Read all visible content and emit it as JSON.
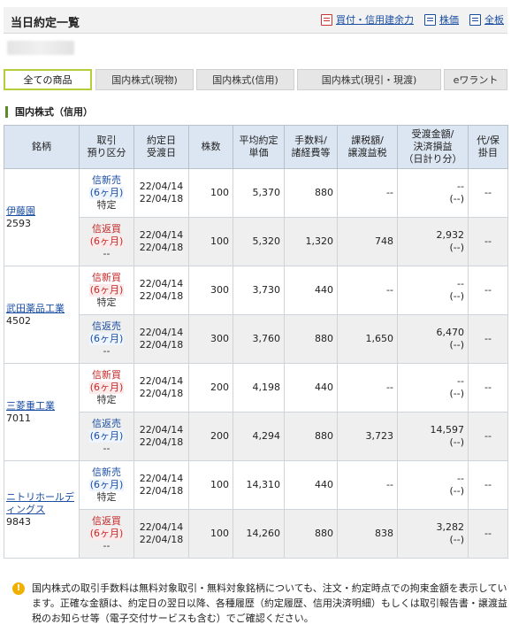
{
  "header": {
    "title": "当日約定一覧",
    "links": [
      "買付・信用建余力",
      "株価",
      "全板"
    ]
  },
  "tabs": [
    "全ての商品",
    "国内株式(現物)",
    "国内株式(信用)",
    "国内株式(現引・現渡)",
    "eワラント"
  ],
  "section": {
    "title": "国内株式（信用）"
  },
  "table": {
    "headers": {
      "name": "銘柄",
      "trade": "取引\n預り区分",
      "date": "約定日\n受渡日",
      "qty": "株数",
      "price": "平均約定\n単価",
      "fee": "手数料/\n諸経費等",
      "tax": "課税額/\n譲渡益税",
      "settle": "受渡金額/\n決済損益\n（日計り分）",
      "sub": "代/保\n掛目"
    },
    "groups": [
      {
        "name": "伊藤園",
        "code": "2593",
        "rows": [
          {
            "type": "信新売",
            "days": "(6ヶ月)",
            "acct": "特定",
            "d1": "22/04/14",
            "d2": "22/04/18",
            "qty": "100",
            "price": "5,370",
            "fee": "880",
            "tax": "--",
            "s1": "--",
            "s2": "(--)",
            "sub": "--"
          },
          {
            "type": "信返買",
            "days": "(6ヶ月)",
            "acct": "--",
            "d1": "22/04/14",
            "d2": "22/04/18",
            "qty": "100",
            "price": "5,320",
            "fee": "1,320",
            "tax": "748",
            "s1": "2,932",
            "s2": "(--)",
            "sub": "--"
          }
        ]
      },
      {
        "name": "武田薬品工業",
        "code": "4502",
        "rows": [
          {
            "type": "信新買",
            "days": "(6ヶ月)",
            "acct": "特定",
            "d1": "22/04/14",
            "d2": "22/04/18",
            "qty": "300",
            "price": "3,730",
            "fee": "440",
            "tax": "--",
            "s1": "--",
            "s2": "(--)",
            "sub": "--"
          },
          {
            "type": "信返売",
            "days": "(6ヶ月)",
            "acct": "--",
            "d1": "22/04/14",
            "d2": "22/04/18",
            "qty": "300",
            "price": "3,760",
            "fee": "880",
            "tax": "1,650",
            "s1": "6,470",
            "s2": "(--)",
            "sub": "--"
          }
        ]
      },
      {
        "name": "三菱重工業",
        "code": "7011",
        "rows": [
          {
            "type": "信新買",
            "days": "(6ヶ月)",
            "acct": "特定",
            "d1": "22/04/14",
            "d2": "22/04/18",
            "qty": "200",
            "price": "4,198",
            "fee": "440",
            "tax": "--",
            "s1": "--",
            "s2": "(--)",
            "sub": "--"
          },
          {
            "type": "信返売",
            "days": "(6ヶ月)",
            "acct": "--",
            "d1": "22/04/14",
            "d2": "22/04/18",
            "qty": "200",
            "price": "4,294",
            "fee": "880",
            "tax": "3,723",
            "s1": "14,597",
            "s2": "(--)",
            "sub": "--"
          }
        ]
      },
      {
        "name": "ニトリホールディングス",
        "code": "9843",
        "rows": [
          {
            "type": "信新売",
            "days": "(6ヶ月)",
            "acct": "特定",
            "d1": "22/04/14",
            "d2": "22/04/18",
            "qty": "100",
            "price": "14,310",
            "fee": "440",
            "tax": "--",
            "s1": "--",
            "s2": "(--)",
            "sub": "--"
          },
          {
            "type": "信返買",
            "days": "(6ヶ月)",
            "acct": "--",
            "d1": "22/04/14",
            "d2": "22/04/18",
            "qty": "100",
            "price": "14,260",
            "fee": "880",
            "tax": "838",
            "s1": "3,282",
            "s2": "(--)",
            "sub": "--"
          }
        ]
      }
    ]
  },
  "note": {
    "icon": "warning-icon",
    "text": "国内株式の取引手数料は無料対象取引・無料対象銘柄についても、注文・約定時点での拘束金額を表示しています。正確な金額は、約定日の翌日以降、各種履歴（約定履歴、信用決済明細）もしくは取引報告書・譲渡益税のお知らせ等（電子交付サービスも含む）でご確認ください。"
  },
  "colors": {
    "accent": "#b6cc3a",
    "header_bg": "#dce6f2",
    "link": "#1a4ea3",
    "sell_red": "#c62828"
  }
}
